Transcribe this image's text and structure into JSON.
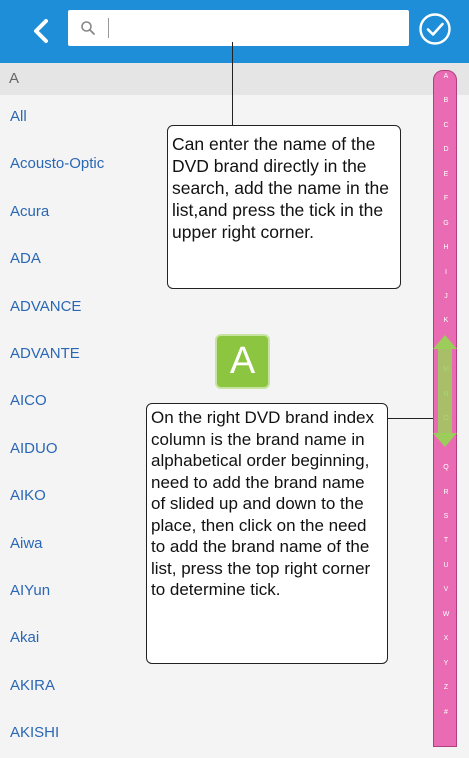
{
  "search": {
    "placeholder": "",
    "value": ""
  },
  "section_header": "A",
  "brand_list": [
    "All",
    "Acousto-Optic",
    "Acura",
    "ADA",
    "ADVANCE",
    "ADVANTE",
    "AICO",
    "AIDUO",
    "AIKO",
    "Aiwa",
    "AIYun",
    "Akai",
    "AKIRA",
    "AKISHI"
  ],
  "index_letters": [
    "A",
    "B",
    "C",
    "D",
    "E",
    "F",
    "G",
    "H",
    "I",
    "J",
    "K",
    "L",
    "M",
    "N",
    "O",
    "P",
    "Q",
    "R",
    "S",
    "T",
    "U",
    "V",
    "W",
    "X",
    "Y",
    "Z",
    "#"
  ],
  "current_letter_badge": "A",
  "annotations": {
    "search_tip": "Can enter the name of the DVD brand directly in the search, add the name in the list,and press the tick in the upper right corner.",
    "index_tip": "On the right DVD brand index column is the brand name in alphabetical order beginning, need to add the brand name of slided up and down to the place, then click on the need to add the brand name of the list, press the top right corner to determine tick."
  },
  "colors": {
    "header": "#1e8ed8",
    "index_column": "#e86bb4",
    "badge": "#8cc540",
    "link": "#2a67b4"
  }
}
